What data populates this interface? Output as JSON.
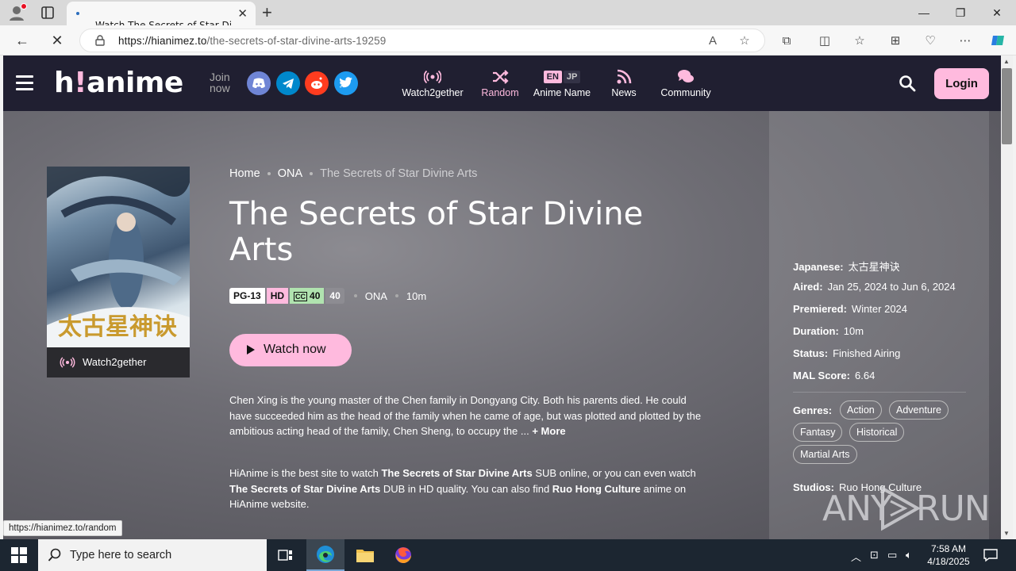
{
  "browser": {
    "tab_title": "Watch The Secrets of Star Divine",
    "url_domain": "https://hianimez.to",
    "url_path": "/the-secrets-of-star-divine-arts-19259",
    "status_url": "https://hianimez.to/random"
  },
  "header": {
    "logo_main": "h",
    "logo_bang": "!",
    "logo_rest": "anime",
    "join_line1": "Join",
    "join_line2": "now",
    "nav": [
      {
        "label": "Watch2gether"
      },
      {
        "label": "Random"
      },
      {
        "label": "Anime Name",
        "en": "EN",
        "jp": "JP"
      },
      {
        "label": "News"
      },
      {
        "label": "Community"
      }
    ],
    "login_label": "Login"
  },
  "anime": {
    "breadcrumb": [
      "Home",
      "ONA",
      "The Secrets of Star Divine Arts"
    ],
    "title": "The Secrets of Star Divine Arts",
    "rating": "PG-13",
    "quality": "HD",
    "sub_count": "40",
    "ep_count": "40",
    "type": "ONA",
    "duration_short": "10m",
    "watch_label": "Watch now",
    "watch2gether_label": "Watch2gether",
    "description": "Chen Xing is the young master of the Chen family in Dongyang City. Both his parents died. He could have succeeded him as the head of the family when he came of age, but was plotted and plotted by the ambitious acting head of the family, Chen Sheng, to occupy the ...",
    "more_label": "+ More",
    "promo": {
      "p1": "HiAnime is the best site to watch ",
      "name1": "The Secrets of Star Divine Arts",
      "p2": " SUB online, or you can even watch ",
      "name2": "The Secrets of Star Divine Arts",
      "p3": " DUB in HD quality. You can also find ",
      "studio": "Ruo Hong Culture",
      "p4": " anime on HiAnime website."
    }
  },
  "info": {
    "japanese_k": "Japanese:",
    "japanese_v": "太古星神诀",
    "aired_k": "Aired:",
    "aired_v": "Jan 25, 2024 to Jun 6, 2024",
    "premiered_k": "Premiered:",
    "premiered_v": "Winter 2024",
    "duration_k": "Duration:",
    "duration_v": "10m",
    "status_k": "Status:",
    "status_v": "Finished Airing",
    "mal_k": "MAL Score:",
    "mal_v": "6.64",
    "genres_k": "Genres:",
    "genres": [
      "Action",
      "Adventure",
      "Fantasy",
      "Historical",
      "Martial Arts"
    ],
    "studios_k": "Studios:",
    "studios_v": "Ruo Hong Culture"
  },
  "watermark": {
    "left": "ANY",
    "right": "RUN"
  },
  "taskbar": {
    "search_placeholder": "Type here to search",
    "time": "7:58 AM",
    "date": "4/18/2025"
  },
  "colors": {
    "accent": "#ffbade",
    "header_bg": "#201f31",
    "sub_badge": "#b0e3af"
  }
}
